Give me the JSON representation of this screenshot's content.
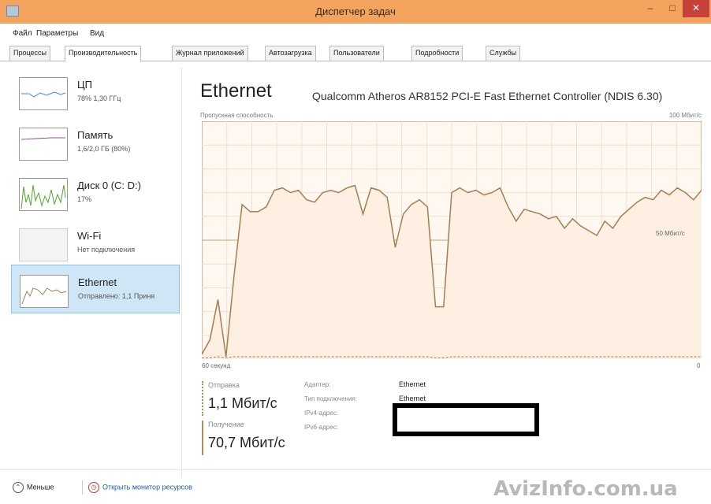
{
  "window": {
    "title": "Диспетчер задач"
  },
  "menu": {
    "file": "Файл",
    "params": "Параметры",
    "view": "Вид"
  },
  "tabs": [
    {
      "label": "Процессы"
    },
    {
      "label": "Производительность"
    },
    {
      "label": "Журнал приложений"
    },
    {
      "label": "Автозагрузка"
    },
    {
      "label": "Пользователи"
    },
    {
      "label": "Подробности"
    },
    {
      "label": "Службы"
    }
  ],
  "sidebar": {
    "items": [
      {
        "title": "ЦП",
        "sub": "78% 1,30 ГГц",
        "color": "#3c8ed2"
      },
      {
        "title": "Память",
        "sub": "1,6/2,0 ГБ (80%)",
        "color": "#9b4c9e"
      },
      {
        "title": "Диск 0 (C: D:)",
        "sub": "17%",
        "color": "#4caa2c"
      },
      {
        "title": "Wi-Fi",
        "sub": "Нет подключения",
        "color": "#9a9a9a"
      },
      {
        "title": "Ethernet",
        "sub": "Отправлено: 1,1 Приня",
        "color": "#a77d4f"
      }
    ]
  },
  "main": {
    "title": "Ethernet",
    "adapter": "Qualcomm Atheros AR8152 PCI-E Fast Ethernet Controller (NDIS 6.30)",
    "capacity_label": "Пропускная способность",
    "capacity_max": "100 Мбит/с",
    "mid_label": "50 Мбит/с",
    "time_left": "60 секунд",
    "time_right": "0"
  },
  "stats": {
    "send_label": "Отправка",
    "send_value": "1,1 Мбит/с",
    "recv_label": "Получение",
    "recv_value": "70,7 Мбит/с"
  },
  "info": {
    "adapter_label": "Адаптер:",
    "adapter_value": "Ethernet",
    "conn_type_label": "Тип подключения:",
    "conn_type_value": "Ethernet",
    "ipv4_label": "IPv4-адрес:",
    "ipv6_label": "IPv6-адрес:"
  },
  "footer": {
    "less_label": "Меньше",
    "monitor_label": "Открыть монитор ресурсов",
    "watermark": "AvizInfo.com.ua"
  },
  "colors": {
    "titlebar": "#f2a45e",
    "graph_line": "#a77d4f",
    "graph_fill": "#fdefe2",
    "selected_bg": "#cfe6f6"
  },
  "chart_data": {
    "type": "area",
    "ylabel": "Пропускная способность",
    "ylim": [
      0,
      100
    ],
    "xlim": [
      60,
      0
    ],
    "series": [
      {
        "values": [
          2,
          8,
          25,
          1,
          35,
          65,
          62,
          62,
          64,
          71,
          72,
          70,
          71,
          67,
          66,
          70,
          71,
          70,
          72,
          73,
          61,
          72,
          71,
          68,
          47,
          61,
          65,
          67,
          64,
          22,
          22,
          70,
          72,
          70,
          71,
          69,
          70,
          72,
          64,
          58,
          63,
          62,
          61,
          59,
          60,
          55,
          59,
          56,
          54,
          52,
          58,
          55,
          60,
          63,
          66,
          68,
          67,
          71,
          69,
          72,
          70,
          67,
          71
        ]
      },
      {
        "values": [
          0.5,
          0.5,
          1,
          0.5,
          1,
          1,
          1,
          1,
          1,
          1,
          1,
          1,
          1,
          1,
          1,
          1,
          1,
          1,
          1,
          1,
          1,
          1,
          1,
          1,
          1,
          1,
          1,
          1,
          1,
          0.5,
          0.5,
          1,
          1,
          1,
          1,
          1,
          1,
          1,
          1,
          1,
          1,
          1,
          1,
          1,
          1,
          1,
          1,
          1,
          1,
          1,
          1,
          1,
          1,
          1,
          1,
          1,
          1,
          1,
          1,
          1,
          1,
          1,
          1
        ]
      }
    ],
    "grid": true,
    "legend": "none"
  }
}
